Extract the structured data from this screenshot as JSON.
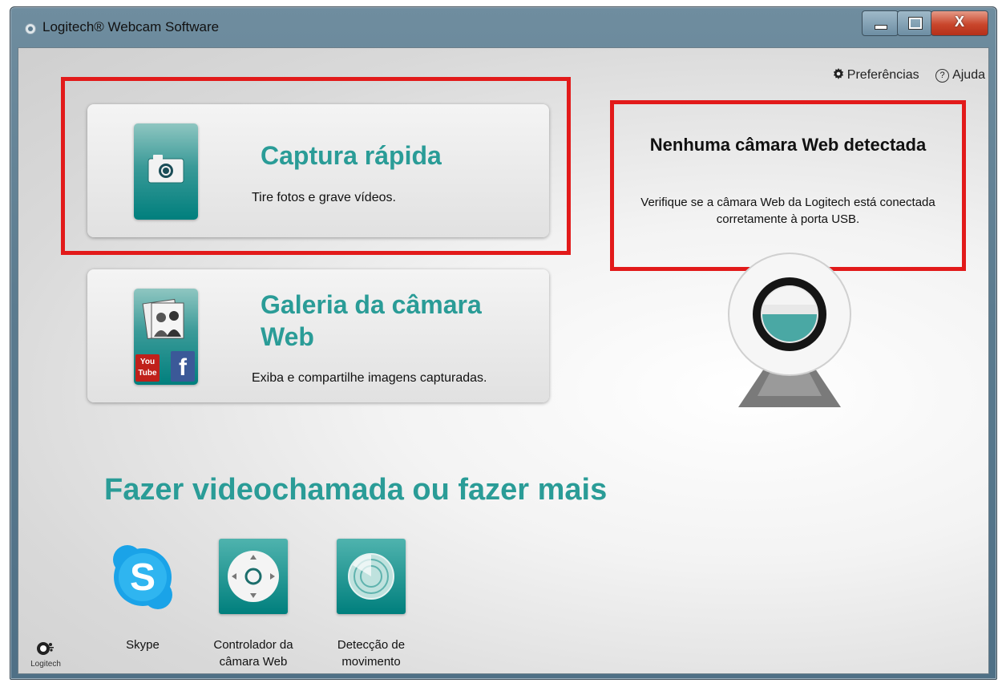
{
  "window": {
    "title": "Logitech® Webcam Software",
    "close_label": "X"
  },
  "toplinks": {
    "preferences": "Preferências",
    "help": "Ajuda",
    "help_glyph": "?"
  },
  "cards": [
    {
      "title": "Captura rápida",
      "description": "Tire fotos e grave vídeos."
    },
    {
      "title": "Galeria da câmara Web",
      "description": "Exiba e compartilhe imagens capturadas."
    }
  ],
  "status": {
    "title": "Nenhuma câmara Web detectada",
    "message": "Verifique se a câmara Web da Logitech está conectada corretamente à porta USB."
  },
  "section": {
    "title": "Fazer videochamada ou fazer mais"
  },
  "apps": [
    {
      "label": "Skype",
      "icon": "skype-icon"
    },
    {
      "label": "Controlador da câmara Web",
      "icon": "camera-controller-icon"
    },
    {
      "label": "Detecção de movimento",
      "icon": "motion-detection-icon"
    }
  ],
  "gallery_badges": {
    "youtube": "You Tube",
    "facebook": "f"
  },
  "brand": {
    "logo_text": "Logitech"
  },
  "colors": {
    "accent": "#2a9c97",
    "highlight_box": "#e21a1a"
  }
}
